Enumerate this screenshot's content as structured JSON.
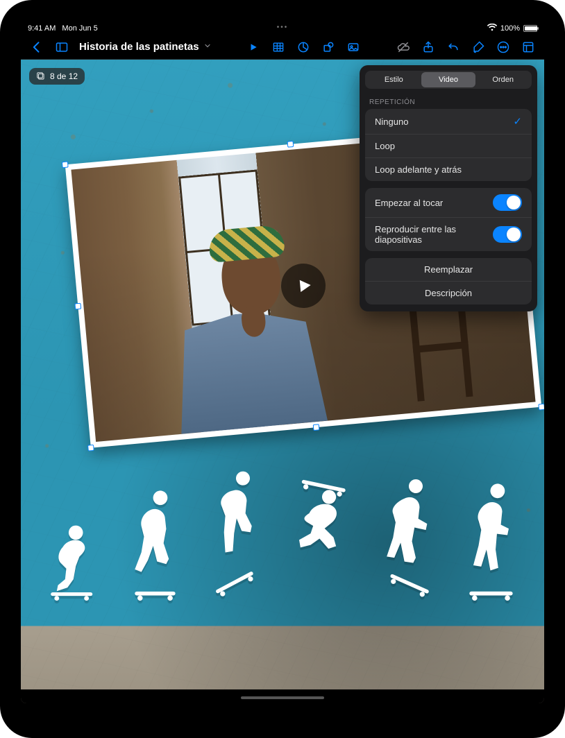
{
  "status": {
    "time": "9:41 AM",
    "date": "Mon Jun 5",
    "battery_pct": "100%"
  },
  "doc": {
    "title": "Historia de las patinetas"
  },
  "slide_counter": {
    "text": "8 de 12"
  },
  "popover": {
    "tabs": {
      "style": "Estilo",
      "video": "Video",
      "order": "Orden",
      "active": "video"
    },
    "section_repeat": "REPETICIÓN",
    "repeat_options": {
      "none": {
        "label": "Ninguno",
        "selected": true
      },
      "loop": {
        "label": "Loop",
        "selected": false
      },
      "pingpong": {
        "label": "Loop adelante y atrás",
        "selected": false
      }
    },
    "toggles": {
      "start_on_tap": {
        "label": "Empezar al tocar",
        "on": true
      },
      "play_across": {
        "label": "Reproducir entre las diapositivas",
        "on": true
      }
    },
    "actions": {
      "replace": "Reemplazar",
      "description": "Descripción"
    }
  },
  "toolbar_icons": {
    "back": "chevron-left",
    "sidebar": "sidebar",
    "title_chev": "chevron-down",
    "play": "play",
    "table": "table",
    "chart": "chart",
    "shape": "shape",
    "media": "photo",
    "cloud": "cloud-off",
    "share": "share",
    "undo": "undo",
    "format": "brush",
    "more": "ellipsis",
    "inspector": "panel"
  }
}
